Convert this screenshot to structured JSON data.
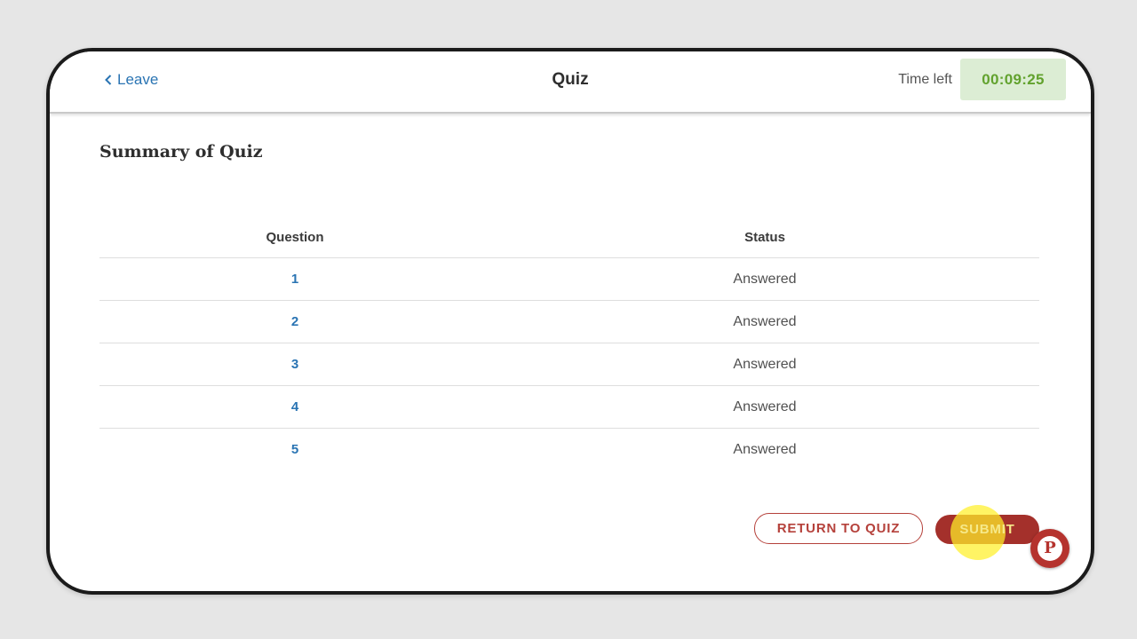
{
  "header": {
    "leave_label": "Leave",
    "title": "Quiz",
    "time_left_label": "Time left",
    "timer_value": "00:09:25"
  },
  "summary": {
    "title": "Summary of Quiz",
    "columns": {
      "question": "Question",
      "status": "Status"
    },
    "rows": [
      {
        "number": "1",
        "status": "Answered"
      },
      {
        "number": "2",
        "status": "Answered"
      },
      {
        "number": "3",
        "status": "Answered"
      },
      {
        "number": "4",
        "status": "Answered"
      },
      {
        "number": "5",
        "status": "Answered"
      }
    ]
  },
  "actions": {
    "return_label": "RETURN TO QUIZ",
    "submit_label": "SUBMIT"
  },
  "help_badge": {
    "letter": "P",
    "icon": "p-badge-icon"
  },
  "colors": {
    "link_blue": "#2a74b3",
    "timer_green": "#62a22e",
    "timer_bg": "#dcedd4",
    "brand_red": "#a4302b",
    "highlight_yellow": "#fff028"
  }
}
